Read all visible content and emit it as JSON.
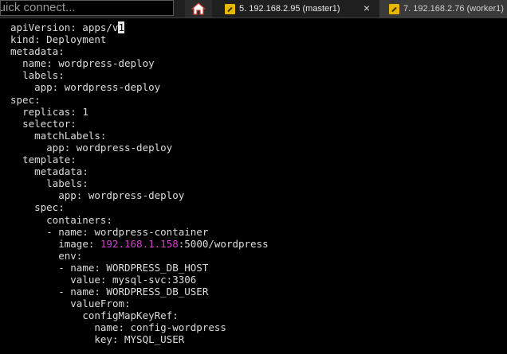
{
  "quick_connect": {
    "placeholder": "Quick connect..."
  },
  "tabs": [
    {
      "label": "5. 192.168.2.95 (master1)",
      "icon": "session-icon",
      "active": true,
      "close": "×"
    },
    {
      "label": "7. 192.168.2.76 (worker1)",
      "icon": "session-icon",
      "active": false
    }
  ],
  "terminal": {
    "lines": [
      {
        "indent": "",
        "text": "apiVersion: apps/v",
        "cursor": "1"
      },
      {
        "indent": "",
        "text": "kind: Deployment"
      },
      {
        "indent": "",
        "text": "metadata:"
      },
      {
        "indent": "  ",
        "text": "name: wordpress-deploy"
      },
      {
        "indent": "  ",
        "text": "labels:"
      },
      {
        "indent": "    ",
        "text": "app: wordpress-deploy"
      },
      {
        "indent": "",
        "text": "spec:"
      },
      {
        "indent": "  ",
        "text": "replicas: 1"
      },
      {
        "indent": "  ",
        "text": "selector:"
      },
      {
        "indent": "    ",
        "text": "matchLabels:"
      },
      {
        "indent": "      ",
        "text": "app: wordpress-deploy"
      },
      {
        "indent": "  ",
        "text": "template:"
      },
      {
        "indent": "    ",
        "text": "metadata:"
      },
      {
        "indent": "      ",
        "text": "labels:"
      },
      {
        "indent": "        ",
        "text": "app: wordpress-deploy"
      },
      {
        "indent": "    ",
        "text": "spec:"
      },
      {
        "indent": "      ",
        "text": "containers:"
      },
      {
        "indent": "      ",
        "text": "- name: wordpress-container"
      },
      {
        "indent": "        ",
        "text": "image: ",
        "ip": "192.168.1.158",
        "rest": ":5000/wordpress"
      },
      {
        "indent": "        ",
        "text": "env:"
      },
      {
        "indent": "        ",
        "text": "- name: WORDPRESS_DB_HOST"
      },
      {
        "indent": "          ",
        "text": "value: mysql-svc:3306"
      },
      {
        "indent": "        ",
        "text": "- name: WORDPRESS_DB_USER"
      },
      {
        "indent": "          ",
        "text": "valueFrom:"
      },
      {
        "indent": "            ",
        "text": "configMapKeyRef:"
      },
      {
        "indent": "              ",
        "text": "name: config-wordpress"
      },
      {
        "indent": "              ",
        "text": "key: MYSQL_USER"
      }
    ]
  }
}
